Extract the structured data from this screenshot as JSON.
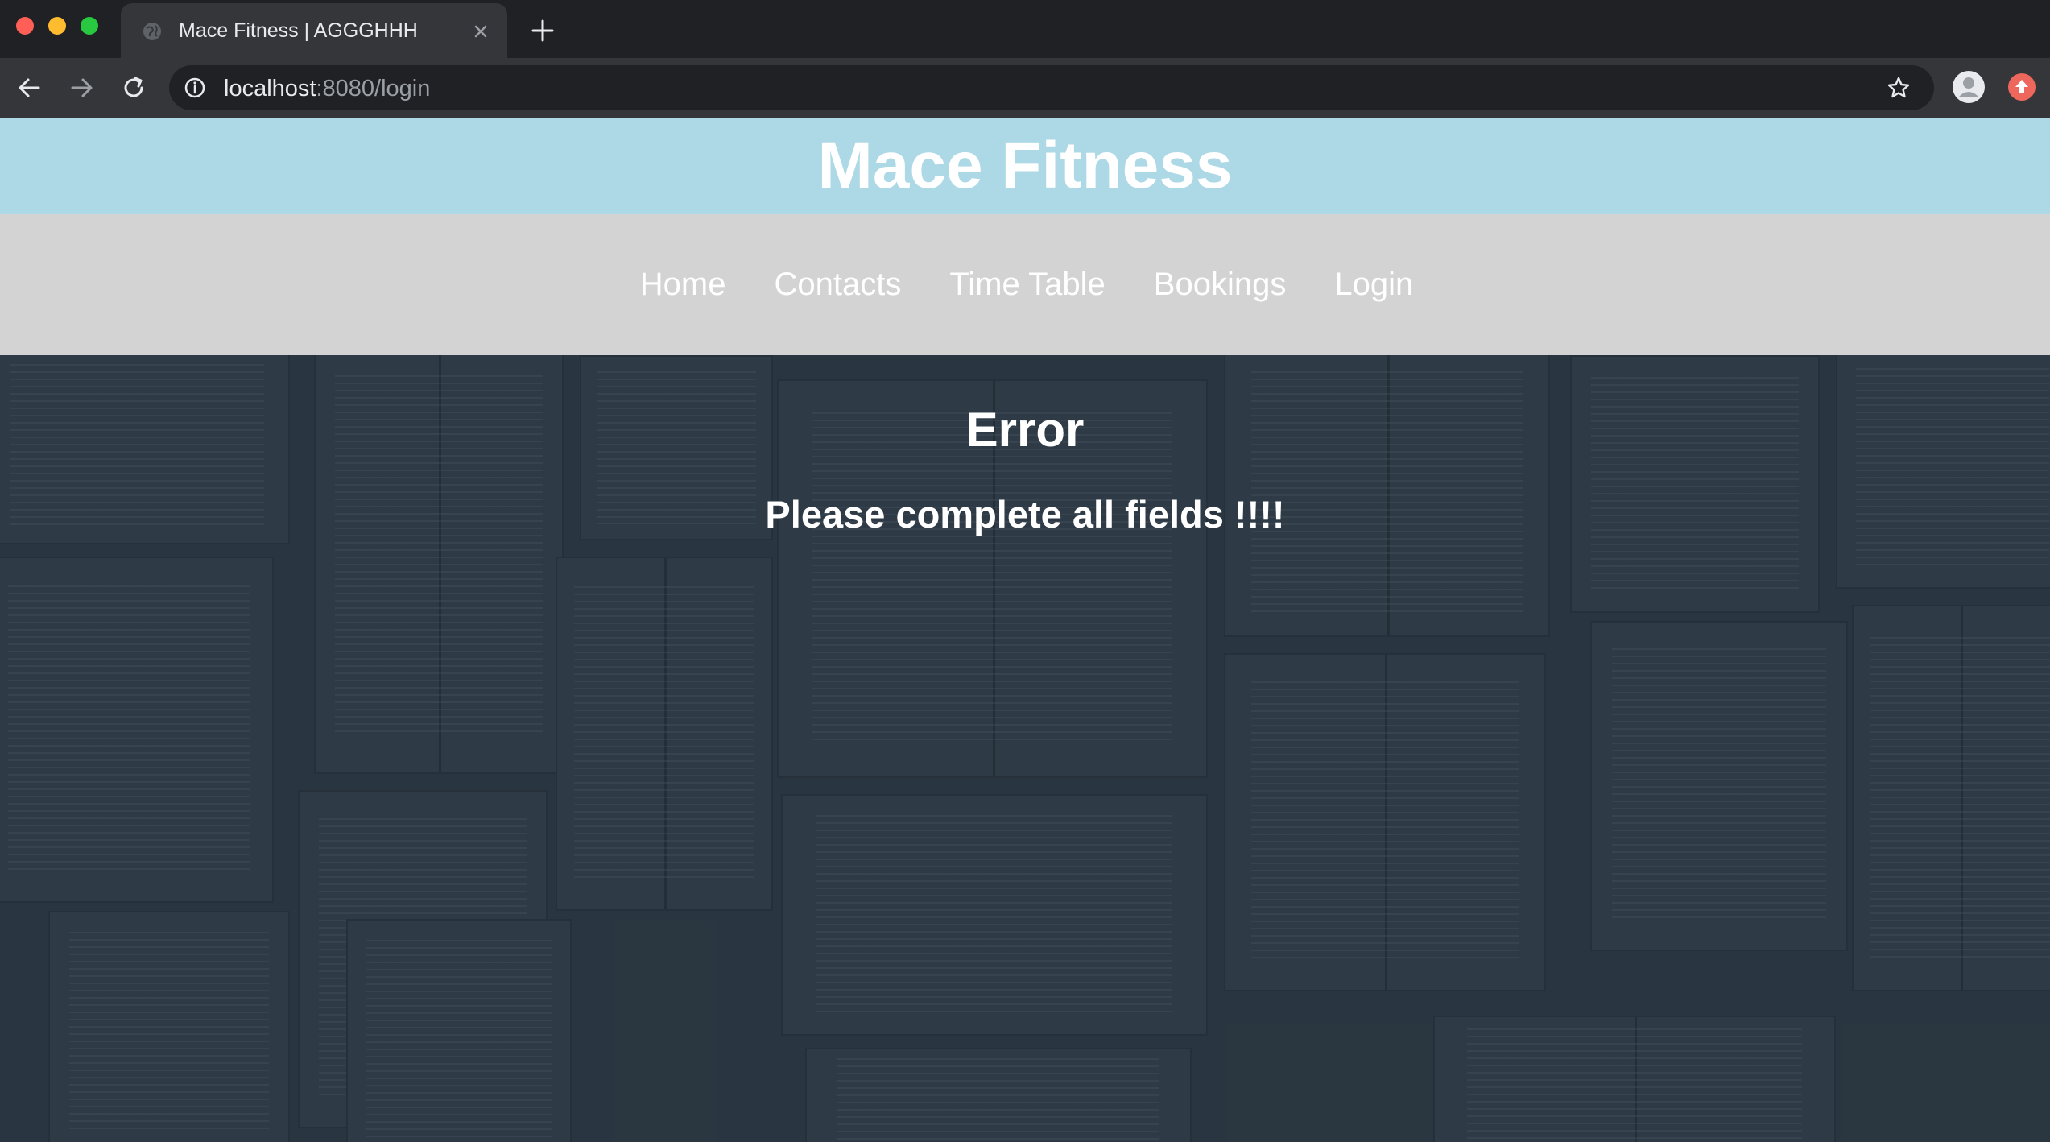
{
  "browser": {
    "tab_title": "Mace Fitness | AGGGHHH",
    "url_host": "localhost",
    "url_path": ":8080/login"
  },
  "site": {
    "title": "Mace Fitness",
    "nav": [
      "Home",
      "Contacts",
      "Time Table",
      "Bookings",
      "Login"
    ]
  },
  "main": {
    "heading": "Error",
    "message": "Please complete all fields !!!!"
  },
  "colors": {
    "header_bg": "#add8e6",
    "nav_bg": "#d3d3d3",
    "content_bg": "#2c3944",
    "text": "#ffffff"
  }
}
